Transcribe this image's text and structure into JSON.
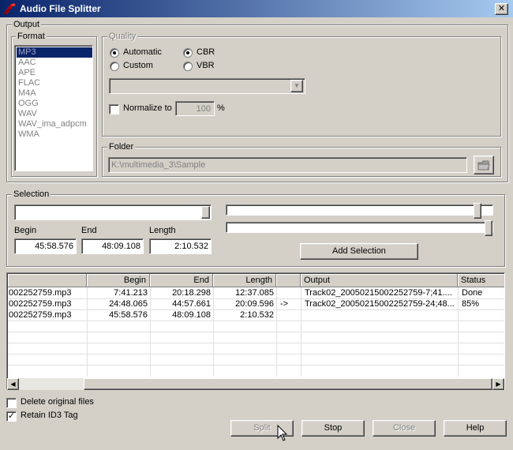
{
  "window": {
    "title": "Audio File Splitter",
    "close_glyph": "✕"
  },
  "output": {
    "label": "Output",
    "format": {
      "label": "Format",
      "items": [
        "MP3",
        "AAC",
        "APE",
        "FLAC",
        "M4A",
        "OGG",
        "WAV",
        "WAV_ima_adpcm",
        "WMA"
      ],
      "selected": "MP3"
    },
    "quality": {
      "label": "Quality",
      "automatic": "Automatic",
      "custom": "Custom",
      "cbr": "CBR",
      "vbr": "VBR",
      "normalize_label": "Normalize to",
      "normalize_value": "100",
      "percent": "%",
      "dropdown_value": ""
    },
    "folder": {
      "label": "Folder",
      "path": "K:\\multimedia_3\\Sample"
    }
  },
  "selection": {
    "label": "Selection",
    "begin_label": "Begin",
    "end_label": "End",
    "length_label": "Length",
    "begin": "45:58.576",
    "end": "48:09.108",
    "length": "2:10.532",
    "add_button": "Add Selection"
  },
  "table": {
    "headers": [
      "",
      "Begin",
      "End",
      "Length",
      "",
      "Output",
      "Status"
    ],
    "rows": [
      [
        "002252759.mp3",
        "7:41.213",
        "20:18.298",
        "12:37.085",
        "",
        "Track02_20050215002252759-7;41....",
        "Done"
      ],
      [
        "002252759.mp3",
        "24:48.065",
        "44:57.661",
        "20:09.596",
        "->",
        "Track02_20050215002252759-24;48...",
        "85%"
      ],
      [
        "002252759.mp3",
        "45:58.576",
        "48:09.108",
        "2:10.532",
        "",
        "",
        ""
      ]
    ]
  },
  "options": {
    "delete_original": "Delete original files",
    "retain_id3": "Retain ID3 Tag",
    "check_glyph": "✓"
  },
  "buttons": {
    "split": "Split",
    "stop": "Stop",
    "close": "Close",
    "help": "Help"
  },
  "colors": {
    "title_start": "#0a246a",
    "title_end": "#a6caf0",
    "face": "#d4d0c8",
    "selection": "#0a246a"
  }
}
